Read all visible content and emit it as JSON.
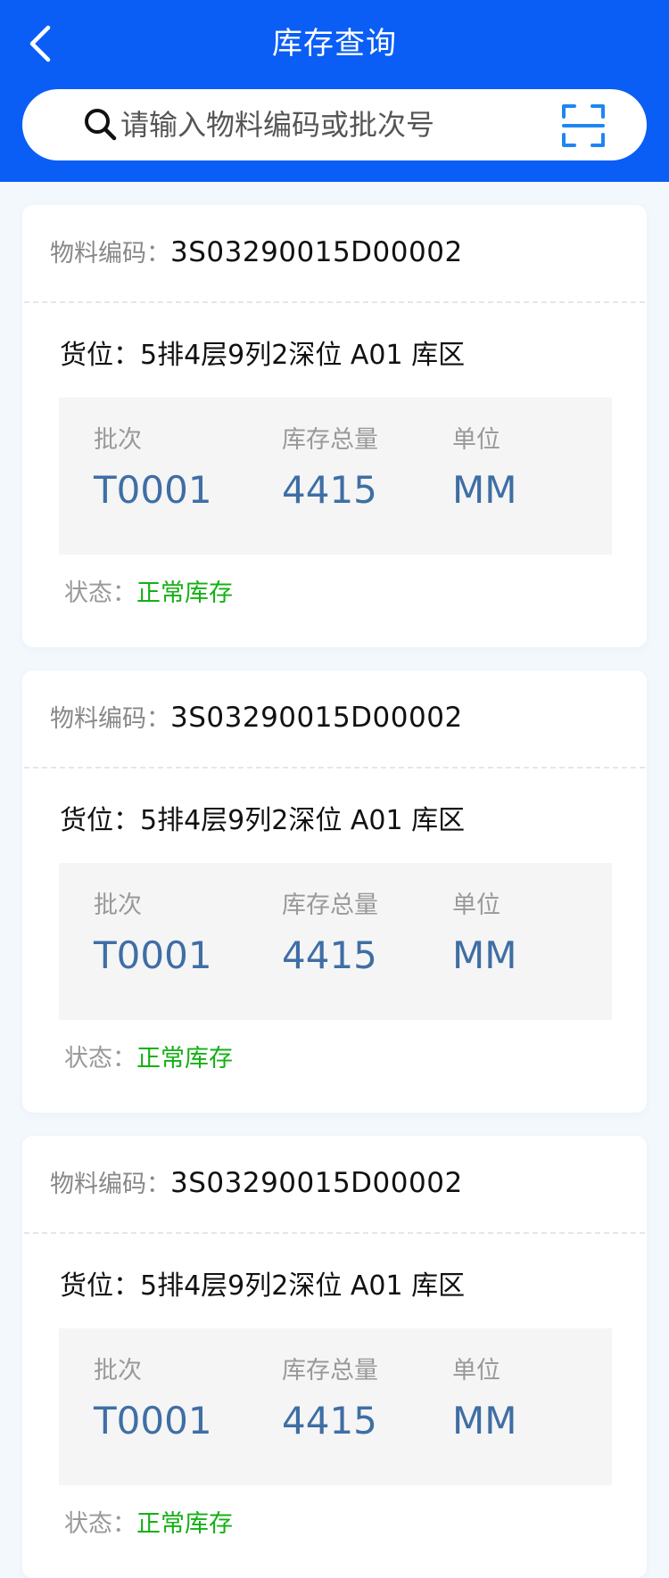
{
  "header": {
    "title": "库存查询",
    "bg_color": "#0a5ef5",
    "back_icon": "chevron-left-icon",
    "search": {
      "placeholder": "请输入物料编码或批次号",
      "value": "",
      "search_icon": "search-icon",
      "scan_icon": "scan-icon"
    }
  },
  "labels": {
    "material_code": "物料编码：",
    "location": "货位：",
    "batch": "批次",
    "total_stock": "库存总量",
    "unit": "单位",
    "status": "状态："
  },
  "colors": {
    "value_blue": "#3f6ea5",
    "status_green": "#14b014"
  },
  "items": [
    {
      "material_code": "3S03290015D00002",
      "location": "5排4层9列2深位 A01 库区",
      "batch": "T0001",
      "total_stock": "4415",
      "unit": "MM",
      "status": "正常库存"
    },
    {
      "material_code": "3S03290015D00002",
      "location": "5排4层9列2深位 A01 库区",
      "batch": "T0001",
      "total_stock": "4415",
      "unit": "MM",
      "status": "正常库存"
    },
    {
      "material_code": "3S03290015D00002",
      "location": "5排4层9列2深位 A01 库区",
      "batch": "T0001",
      "total_stock": "4415",
      "unit": "MM",
      "status": "正常库存"
    }
  ]
}
